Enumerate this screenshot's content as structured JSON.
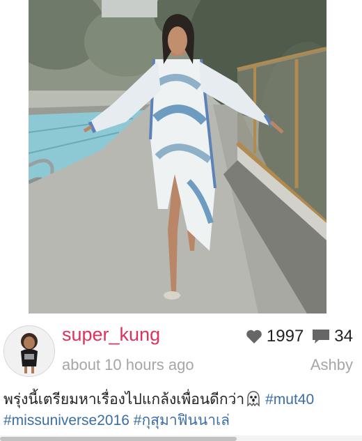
{
  "post": {
    "username": "super_kung",
    "timestamp": "about 10 hours ago",
    "location": "Ashby",
    "likes": "1997",
    "comments": "34",
    "icons": {
      "likes": "heart-icon",
      "comments": "comment-icon",
      "emoji": "ghost-emoji"
    },
    "caption": {
      "text": "พรุ่งนี้เตรียมหาเรื่องไปแกล้งเพื่อนดีกว่า",
      "hashtags": [
        "#mut40",
        "#missuniverse2016",
        "#กุสุมาฟินนาเล่"
      ]
    }
  },
  "colors": {
    "username": "#e0305b",
    "hashtag": "#3b6ea5",
    "meta": "#a6a6a6"
  }
}
